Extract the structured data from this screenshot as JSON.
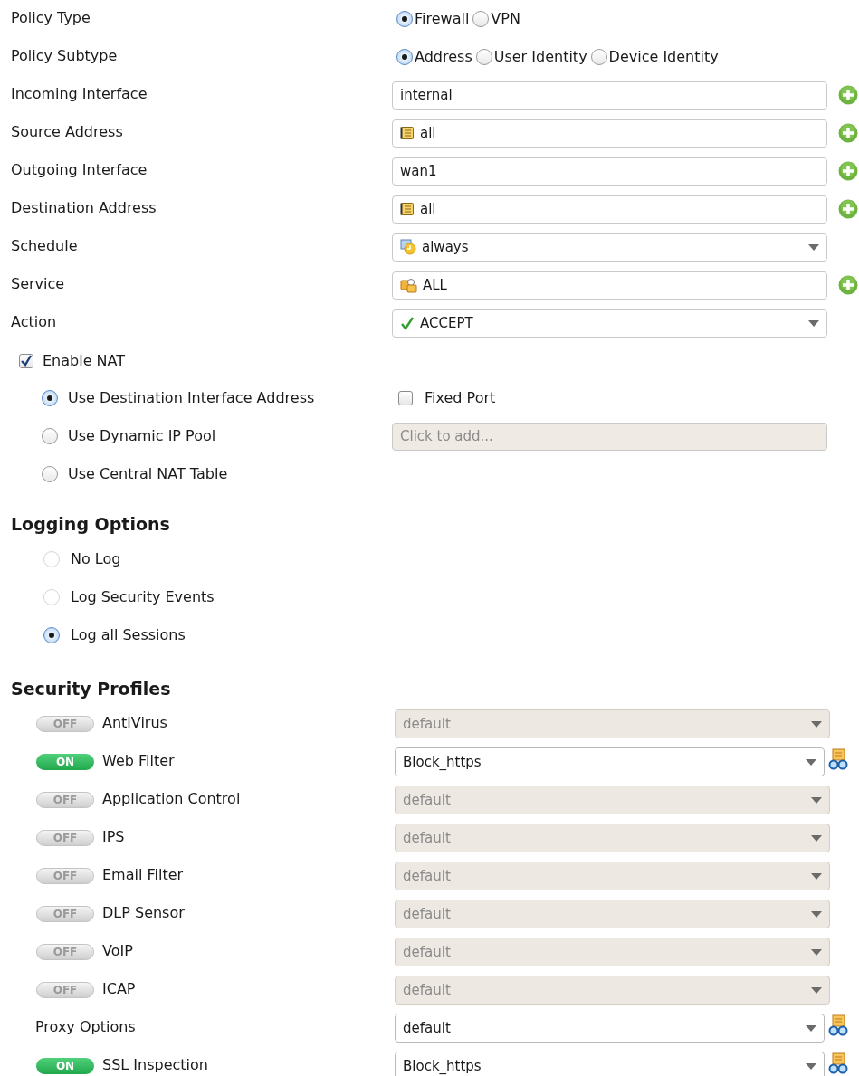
{
  "policy_fields": [
    {
      "label": "Policy Type",
      "kind": "radio_group",
      "options": [
        {
          "label": "Firewall",
          "selected": true
        },
        {
          "label": "VPN",
          "selected": false
        }
      ]
    },
    {
      "label": "Policy Subtype",
      "kind": "radio_group",
      "options": [
        {
          "label": "Address",
          "selected": true
        },
        {
          "label": "User Identity",
          "selected": false
        },
        {
          "label": "Device Identity",
          "selected": false
        }
      ]
    },
    {
      "label": "Incoming Interface",
      "kind": "text",
      "value": "internal",
      "add_button": true
    },
    {
      "label": "Source Address",
      "kind": "address",
      "value": "all",
      "add_button": true
    },
    {
      "label": "Outgoing Interface",
      "kind": "text",
      "value": "wan1",
      "add_button": true
    },
    {
      "label": "Destination Address",
      "kind": "address",
      "value": "all",
      "add_button": true
    },
    {
      "label": "Schedule",
      "kind": "schedule",
      "value": "always",
      "add_button": false
    },
    {
      "label": "Service",
      "kind": "service",
      "value": "ALL",
      "add_button": true
    },
    {
      "label": "Action",
      "kind": "action",
      "value": "ACCEPT",
      "add_button": false
    }
  ],
  "nat": {
    "enable": {
      "label": "Enable NAT",
      "checked": true
    },
    "options": [
      {
        "label": "Use Destination Interface Address",
        "selected": true
      },
      {
        "label": "Use Dynamic IP Pool",
        "selected": false
      },
      {
        "label": "Use Central NAT Table",
        "selected": false
      }
    ],
    "fixed_port": {
      "label": "Fixed Port",
      "checked": false
    },
    "ip_pool": {
      "placeholder": "Click to add...",
      "disabled": true
    }
  },
  "logging": {
    "title": "Logging Options",
    "options": [
      {
        "label": "No Log",
        "selected": false
      },
      {
        "label": "Log Security Events",
        "selected": false
      },
      {
        "label": "Log all Sessions",
        "selected": true
      }
    ]
  },
  "security": {
    "title": "Security Profiles",
    "profiles": [
      {
        "label": "AntiVirus",
        "kind": "toggle",
        "toggle": {
          "label": "OFF",
          "on": false
        },
        "value": "default"
      },
      {
        "label": "Web Filter",
        "kind": "toggle",
        "toggle": {
          "label": "ON",
          "on": true
        },
        "value": "Block_https"
      },
      {
        "label": "Application Control",
        "kind": "toggle",
        "toggle": {
          "label": "OFF",
          "on": false
        },
        "value": "default"
      },
      {
        "label": "IPS",
        "kind": "toggle",
        "toggle": {
          "label": "OFF",
          "on": false
        },
        "value": "default"
      },
      {
        "label": "Email Filter",
        "kind": "toggle",
        "toggle": {
          "label": "OFF",
          "on": false
        },
        "value": "default"
      },
      {
        "label": "DLP Sensor",
        "kind": "toggle",
        "toggle": {
          "label": "OFF",
          "on": false
        },
        "value": "default"
      },
      {
        "label": "VoIP",
        "kind": "toggle",
        "toggle": {
          "label": "OFF",
          "on": false
        },
        "value": "default"
      },
      {
        "label": "ICAP",
        "kind": "toggle",
        "toggle": {
          "label": "OFF",
          "on": false
        },
        "value": "default"
      },
      {
        "label": "Proxy Options",
        "kind": "plain",
        "value": "default"
      },
      {
        "label": "SSL Inspection",
        "kind": "toggle",
        "toggle": {
          "label": "ON",
          "on": true
        },
        "value": "Block_https"
      }
    ]
  }
}
